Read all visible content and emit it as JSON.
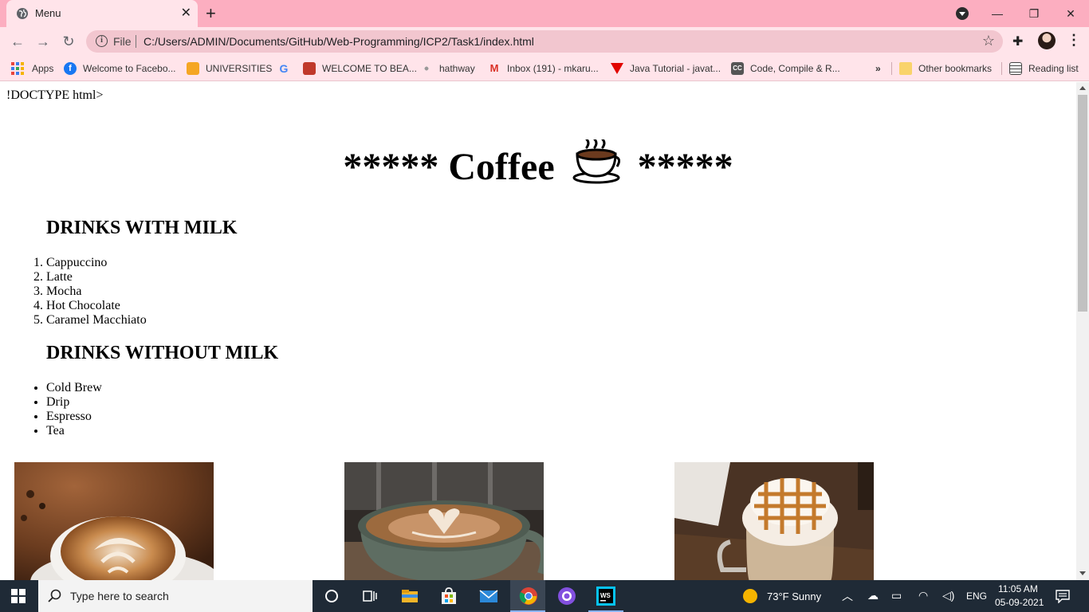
{
  "browser": {
    "tab_title": "Menu",
    "url_scheme_label": "File",
    "url": "C:/Users/ADMIN/Documents/GitHub/Web-Programming/ICP2/Task1/index.html",
    "bookmarks": [
      {
        "label": "Apps"
      },
      {
        "label": "Welcome to Facebo..."
      },
      {
        "label": "UNIVERSITIES"
      },
      {
        "label": ""
      },
      {
        "label": "WELCOME TO BEA..."
      },
      {
        "label": "hathway"
      },
      {
        "label": "Inbox (191) - mkaru..."
      },
      {
        "label": "Java Tutorial - javat..."
      },
      {
        "label": "Code, Compile & R..."
      }
    ],
    "overflow_label": "»",
    "other_bookmarks": "Other bookmarks",
    "reading_list": "Reading list"
  },
  "page": {
    "doctype_text": "!DOCTYPE html>",
    "heading_left": "***** Coffee",
    "heading_right": "*****",
    "section1_title": "DRINKS WITH MILK",
    "milk_drinks": [
      "Cappuccino",
      "Latte",
      "Mocha",
      "Hot Chocolate",
      "Caramel Macchiato"
    ],
    "section2_title": "DRINKS WITHOUT MILK",
    "non_milk_drinks": [
      "Cold Brew",
      "Drip",
      "Espresso",
      "Tea"
    ]
  },
  "taskbar": {
    "search_placeholder": "Type here to search",
    "weather": "73°F  Sunny",
    "language": "ENG",
    "time": "11:05 AM",
    "date": "05-09-2021"
  },
  "colors": {
    "tab_strip": "#fcaec0",
    "toolbar": "#ffe4ea",
    "taskbar": "#1f2a36"
  }
}
